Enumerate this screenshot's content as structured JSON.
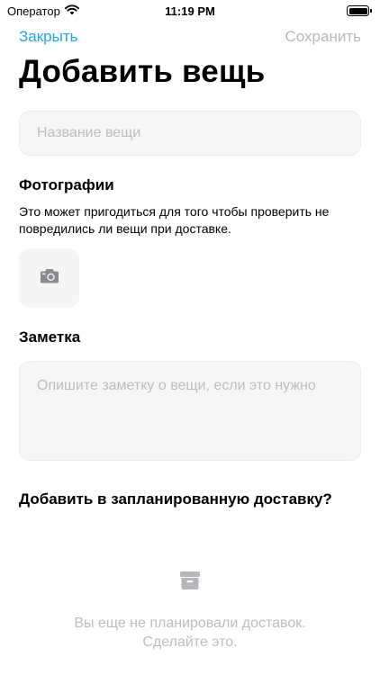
{
  "status_bar": {
    "carrier": "Оператор",
    "time": "11:19 PM",
    "icons": [
      "wifi-icon",
      "battery-icon"
    ]
  },
  "nav": {
    "close_label": "Закрыть",
    "save_label": "Сохранить"
  },
  "title": "Добавить вещь",
  "name_field": {
    "placeholder": "Название вещи",
    "value": ""
  },
  "photos": {
    "title": "Фотографии",
    "description": "Это может пригодиться для того чтобы проверить не повредились ли вещи при доставке.",
    "add_icon": "camera-icon"
  },
  "note": {
    "title": "Заметка",
    "placeholder": "Опишите заметку о вещи, если это нужно",
    "value": ""
  },
  "delivery": {
    "title": "Добавить в запланированную доставку?",
    "empty_icon": "archive-box-icon",
    "empty_line1": "Вы еще не планировали доставок.",
    "empty_line2": "Сделайте это."
  },
  "colors": {
    "accent": "#2aa3e3",
    "disabled": "#b9b9bd",
    "placeholder": "#bdbdc1",
    "field_bg": "#f6f6f7"
  }
}
